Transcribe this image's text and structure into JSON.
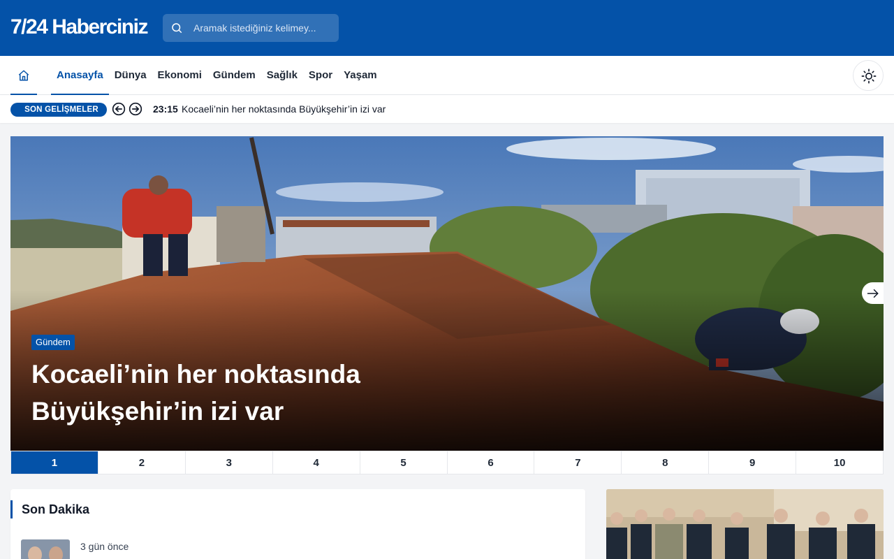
{
  "header": {
    "logo": "7/24 Haberciniz",
    "search_placeholder": "Aramak istediğiniz kelimey..."
  },
  "nav": {
    "home_icon": "home-icon",
    "items": [
      {
        "label": "Anasayfa",
        "active": true
      },
      {
        "label": "Dünya"
      },
      {
        "label": "Ekonomi"
      },
      {
        "label": "Gündem"
      },
      {
        "label": "Sağlık"
      },
      {
        "label": "Spor"
      },
      {
        "label": "Yaşam"
      }
    ],
    "theme_icon": "sun-icon"
  },
  "ticker": {
    "badge": "SON GELİŞMELER",
    "time": "23:15",
    "text": "Kocaeli’nin her noktasında Büyükşehir’in izi var"
  },
  "hero": {
    "category": "Gündem",
    "title": "Kocaeli’nin her noktasında Büyükşehir’in izi var"
  },
  "pager": [
    "1",
    "2",
    "3",
    "4",
    "5",
    "6",
    "7",
    "8",
    "9",
    "10"
  ],
  "son_dakika": {
    "title": "Son Dakika",
    "first_item_time": "3 gün önce"
  },
  "colors": {
    "brand": "#0452a8",
    "background": "#f3f4f6"
  }
}
